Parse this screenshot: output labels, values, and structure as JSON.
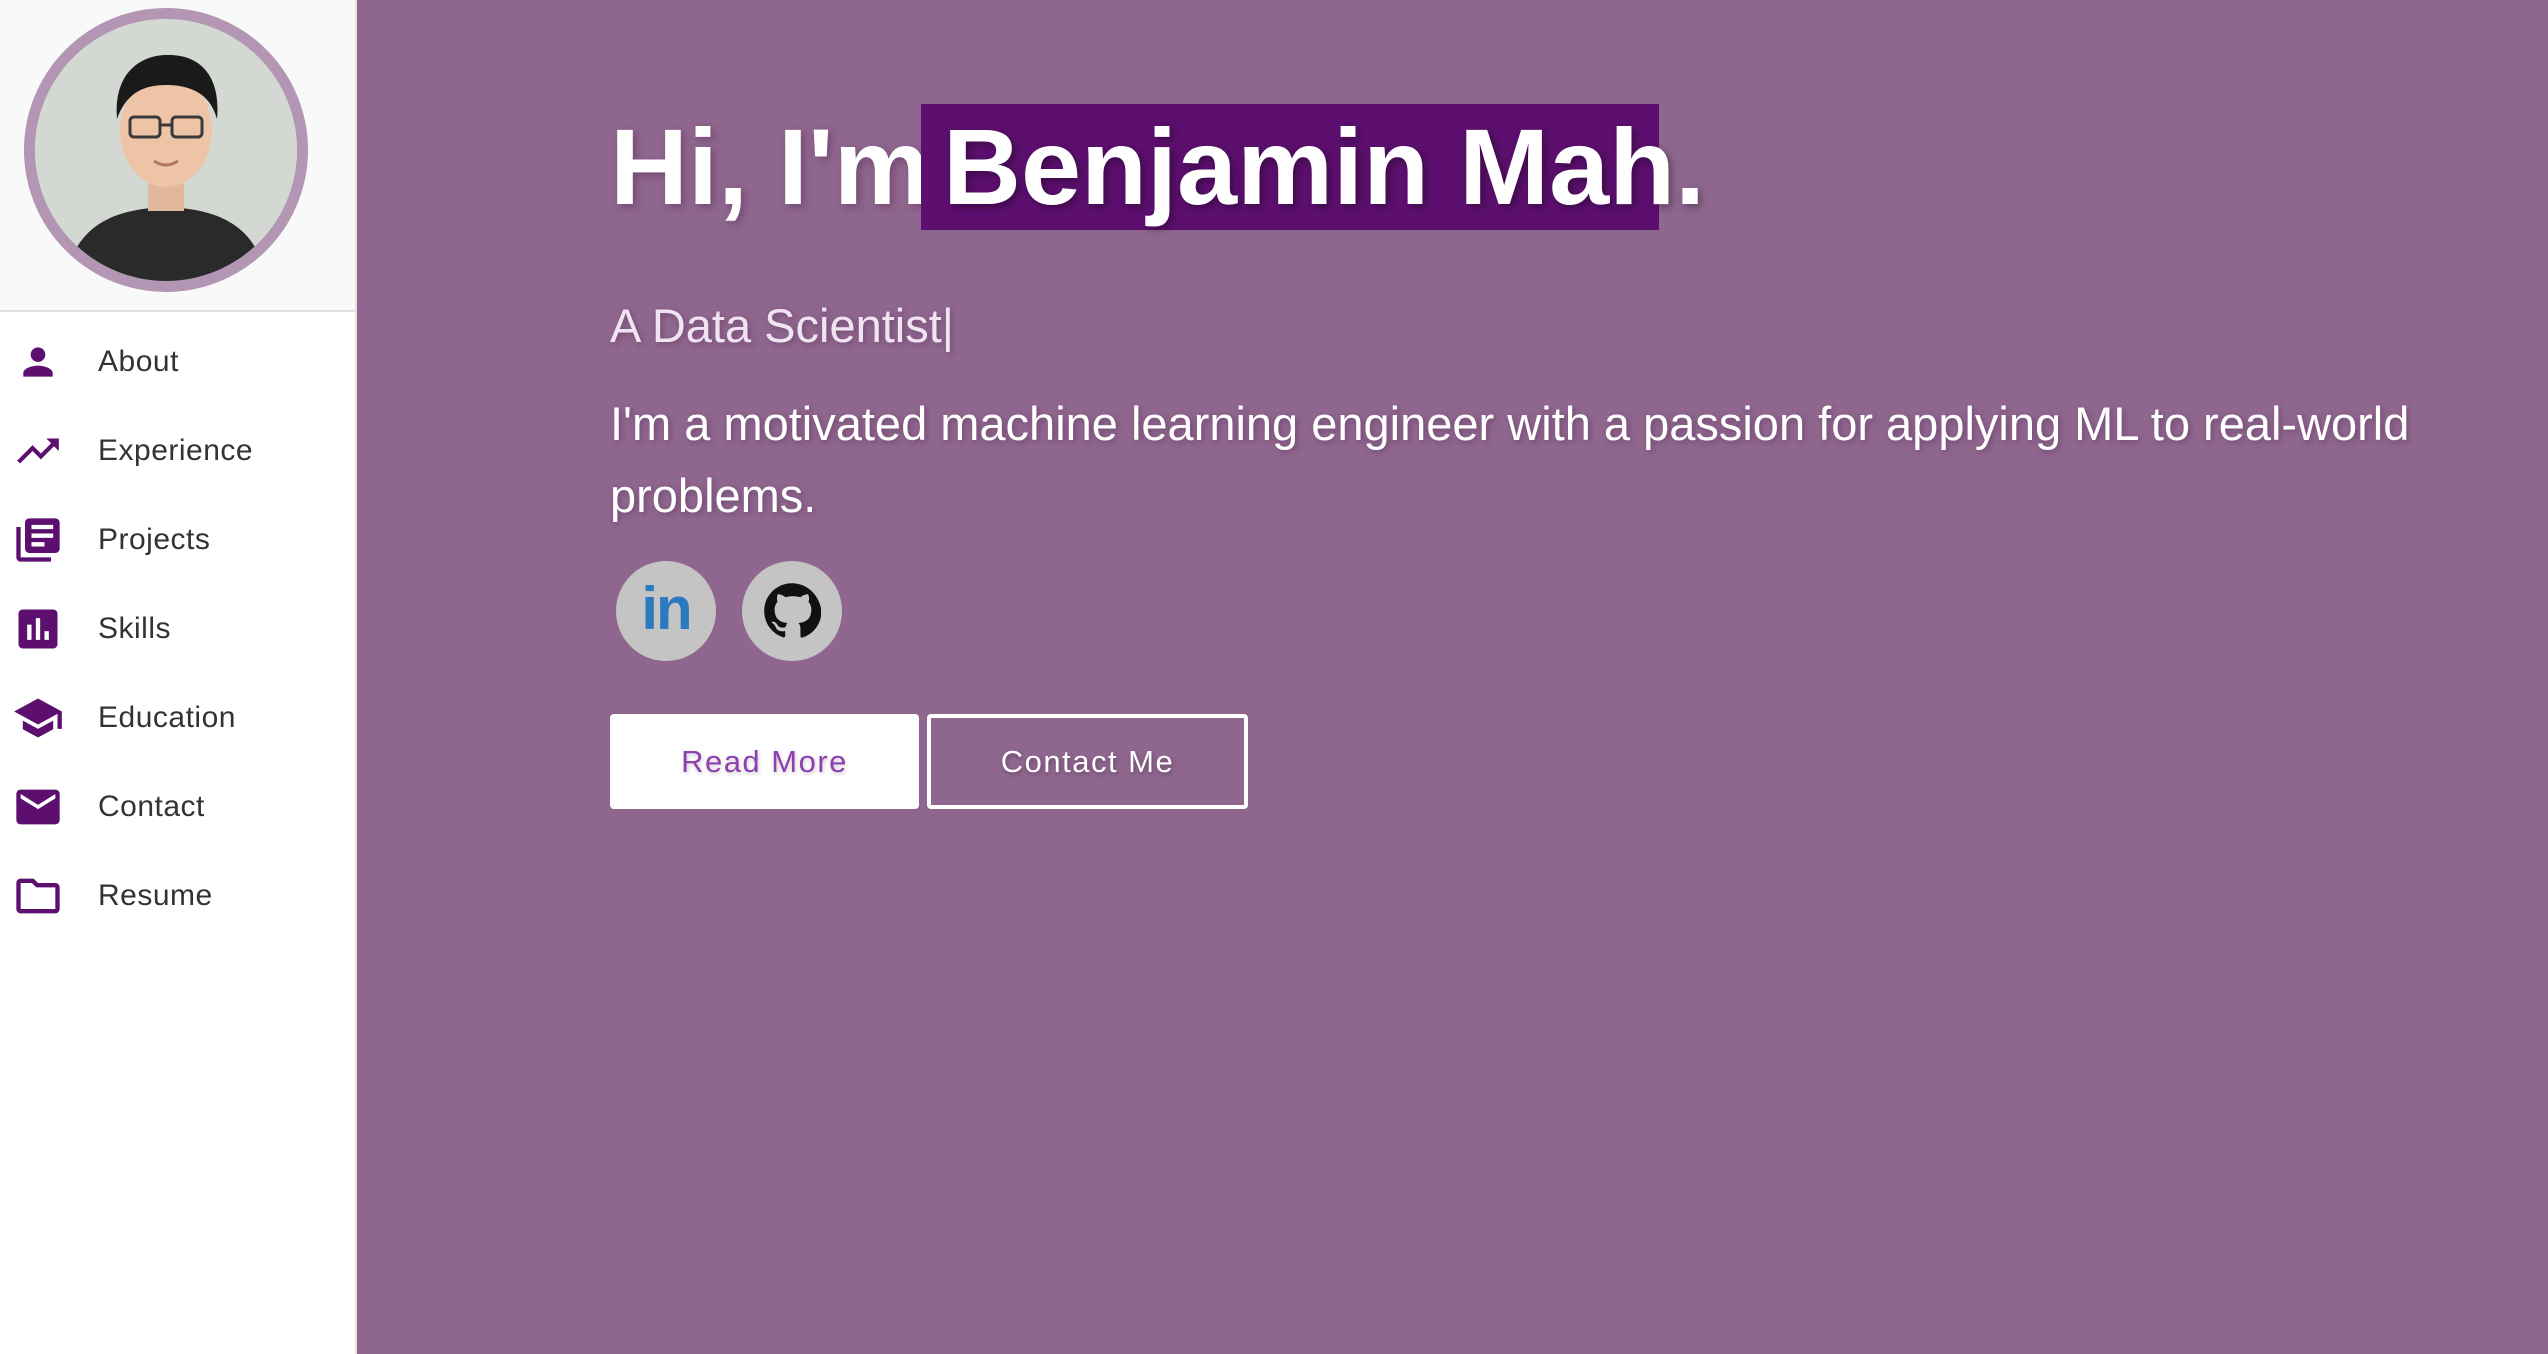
{
  "sidebar": {
    "items": [
      {
        "label": "About",
        "icon": "person-icon"
      },
      {
        "label": "Experience",
        "icon": "trending-up-icon"
      },
      {
        "label": "Projects",
        "icon": "library-books-icon"
      },
      {
        "label": "Skills",
        "icon": "bar-chart-icon"
      },
      {
        "label": "Education",
        "icon": "graduation-cap-icon"
      },
      {
        "label": "Contact",
        "icon": "mail-icon"
      },
      {
        "label": "Resume",
        "icon": "folder-icon"
      }
    ]
  },
  "hero": {
    "greeting_prefix": "Hi, I'm",
    "name": "Benjamin Mah.",
    "typed_role": "A Data Scientist|",
    "description": "I'm a motivated machine learning engineer with a passion for applying ML to real-world problems.",
    "social": [
      {
        "icon": "linkedin-icon",
        "text": "in"
      },
      {
        "icon": "github-icon"
      }
    ],
    "read_more_label": "Read More",
    "contact_label": "Contact Me"
  },
  "colors": {
    "background": "#8f668e",
    "accent": "#5c0f6e",
    "icon": "#5c0f6e",
    "linkedin": "#2b79bf"
  }
}
